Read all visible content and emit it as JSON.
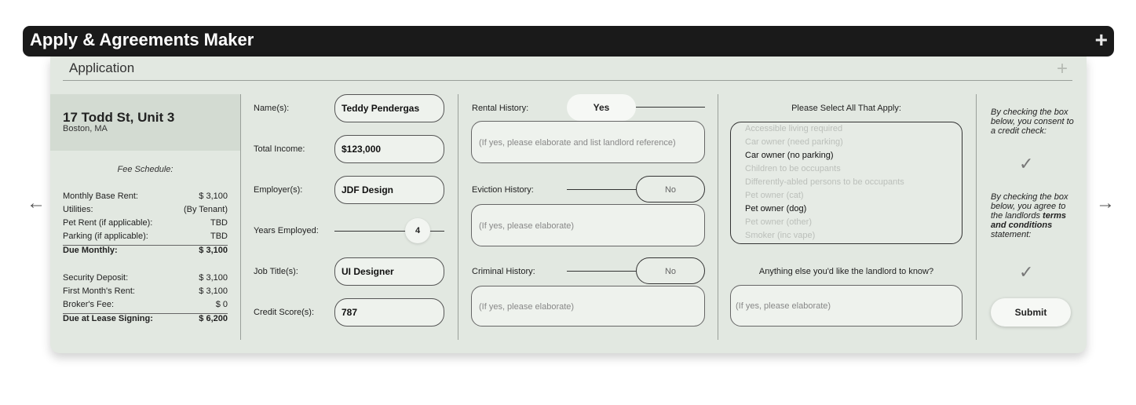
{
  "app": {
    "title": "Apply & Agreements Maker",
    "plus": "+"
  },
  "panel": {
    "title": "Application",
    "plus": "+"
  },
  "nav": {
    "prev": "←",
    "next": "→"
  },
  "property": {
    "address": "17 Todd St, Unit 3",
    "city": "Boston, MA",
    "fee_schedule_title": "Fee Schedule:",
    "fees": [
      {
        "label": "Monthly Base Rent:",
        "value": "$ 3,100"
      },
      {
        "label": "Utilities:",
        "value": "(By Tenant)"
      },
      {
        "label": "Pet Rent (if applicable):",
        "value": "TBD"
      },
      {
        "label": "Parking (if applicable):",
        "value": "TBD"
      },
      {
        "label": "Due Monthly:",
        "value": "$ 3,100"
      },
      {
        "label": "Security Deposit:",
        "value": "$ 3,100"
      },
      {
        "label": "First Month's Rent:",
        "value": "$ 3,100"
      },
      {
        "label": "Broker's Fee:",
        "value": "$ 0"
      },
      {
        "label": "Due at Lease Signing:",
        "value": "$ 6,200"
      }
    ]
  },
  "applicant": {
    "name_label": "Name(s):",
    "name_value": "Teddy Pendergas",
    "income_label": "Total Income:",
    "income_value": "$123,000",
    "employer_label": "Employer(s):",
    "employer_value": "JDF Design",
    "years_label": "Years Employed:",
    "years_value": "4",
    "job_label": "Job Title(s):",
    "job_value": "UI Designer",
    "credit_label": "Credit Score(s):",
    "credit_value": "787"
  },
  "history": {
    "rental_label": "Rental History:",
    "rental_value": "Yes",
    "rental_placeholder": "(If yes, please elaborate and list landlord reference)",
    "eviction_label": "Eviction History:",
    "eviction_value": "No",
    "eviction_placeholder": "(If yes, please elaborate)",
    "criminal_label": "Criminal History:",
    "criminal_value": "No",
    "criminal_placeholder": "(If yes, please elaborate)"
  },
  "apply": {
    "heading": "Please Select All That Apply:",
    "options": [
      {
        "label": "Accessible living required",
        "selected": false
      },
      {
        "label": "Car owner (need parking)",
        "selected": false
      },
      {
        "label": "Car owner (no parking)",
        "selected": true
      },
      {
        "label": "Children to be occupants",
        "selected": false
      },
      {
        "label": "Differently-abled persons to be occupants",
        "selected": false
      },
      {
        "label": "Pet owner (cat)",
        "selected": false
      },
      {
        "label": "Pet owner (dog)",
        "selected": true
      },
      {
        "label": "Pet owner (other)",
        "selected": false
      },
      {
        "label": "Smoker (inc vape)",
        "selected": false
      }
    ],
    "anything_heading": "Anything else you'd like the landlord to know?",
    "anything_placeholder": "(If yes, please elaborate)"
  },
  "consent": {
    "credit_text": "By checking the box below, you consent to a credit check:",
    "terms_text_1": "By checking the box below, you agree to the landlords ",
    "terms_bold": "terms and conditions",
    "terms_text_2": " statement:",
    "check_glyph": "✓",
    "submit_label": "Submit"
  }
}
